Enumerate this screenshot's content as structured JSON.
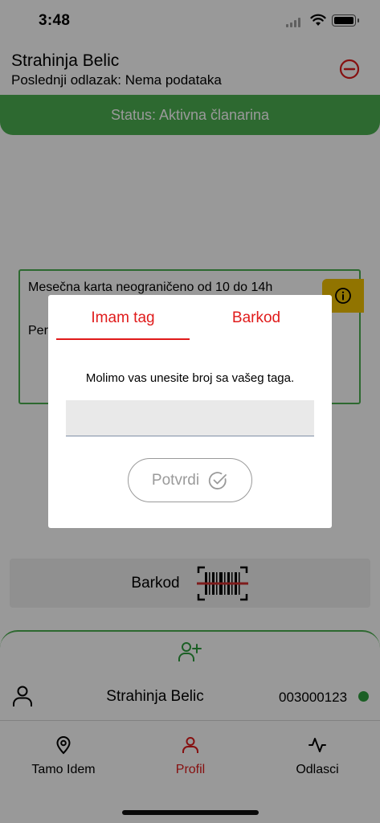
{
  "status_bar": {
    "time": "3:48"
  },
  "header": {
    "user_name": "Strahinja Belic",
    "last_visit": "Poslednji odlazak: Nema podataka"
  },
  "status_banner": {
    "text": "Status: Aktivna članarina"
  },
  "membership": {
    "title": "Mesečna karta neograničeno od 10 do 14h",
    "period_label": "Peri"
  },
  "barcode_button": {
    "label": "Barkod"
  },
  "members": {
    "items": [
      {
        "name": "Strahinja Belic",
        "id": "003000123"
      }
    ]
  },
  "nav": {
    "items": [
      {
        "label": "Tamo Idem",
        "icon": "location-pin-icon"
      },
      {
        "label": "Profil",
        "icon": "person-icon"
      },
      {
        "label": "Odlasci",
        "icon": "activity-icon"
      }
    ]
  },
  "dialog": {
    "tabs": [
      {
        "label": "Imam tag",
        "active": true
      },
      {
        "label": "Barkod",
        "active": false
      }
    ],
    "message": "Molimo vas unesite broj sa vašeg taga.",
    "input_value": "",
    "confirm_label": "Potvrdi"
  },
  "colors": {
    "accent_red": "#e01b1b",
    "status_green": "#4caf50",
    "info_yellow": "#f2c200",
    "online_dot": "#2e9e3e"
  }
}
